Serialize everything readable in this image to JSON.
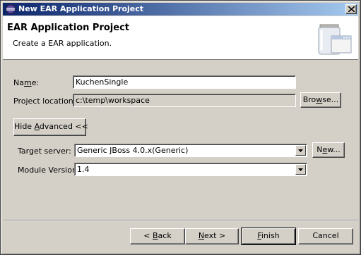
{
  "window": {
    "title": "New EAR Application Project",
    "close_icon": "close-icon"
  },
  "banner": {
    "title": "EAR Application Project",
    "description": "Create a EAR application.",
    "image_icon": "jar-window-icon"
  },
  "form": {
    "name_label_pre": "Na",
    "name_label_u": "m",
    "name_label_post": "e:",
    "name_value": "KuchenSingle",
    "location_label": "Project location:",
    "location_value": "c:\\temp\\workspace",
    "browse_label_pre": "Bro",
    "browse_label_u": "w",
    "browse_label_post": "se...",
    "advanced_pre": "Hide ",
    "advanced_u": "A",
    "advanced_post": "dvanced <<",
    "target_server_label": "Target server:",
    "target_server_value": "Generic JBoss 4.0.x(Generic)",
    "new_label_pre": "N",
    "new_label_u": "e",
    "new_label_post": "w...",
    "module_version_label": "Module Version:",
    "module_version_value": "1.4"
  },
  "footer": {
    "back_pre": "< ",
    "back_u": "B",
    "back_post": "ack",
    "next_pre": "",
    "next_u": "N",
    "next_post": "ext >",
    "finish_pre": "",
    "finish_u": "F",
    "finish_post": "inish",
    "cancel": "Cancel"
  }
}
